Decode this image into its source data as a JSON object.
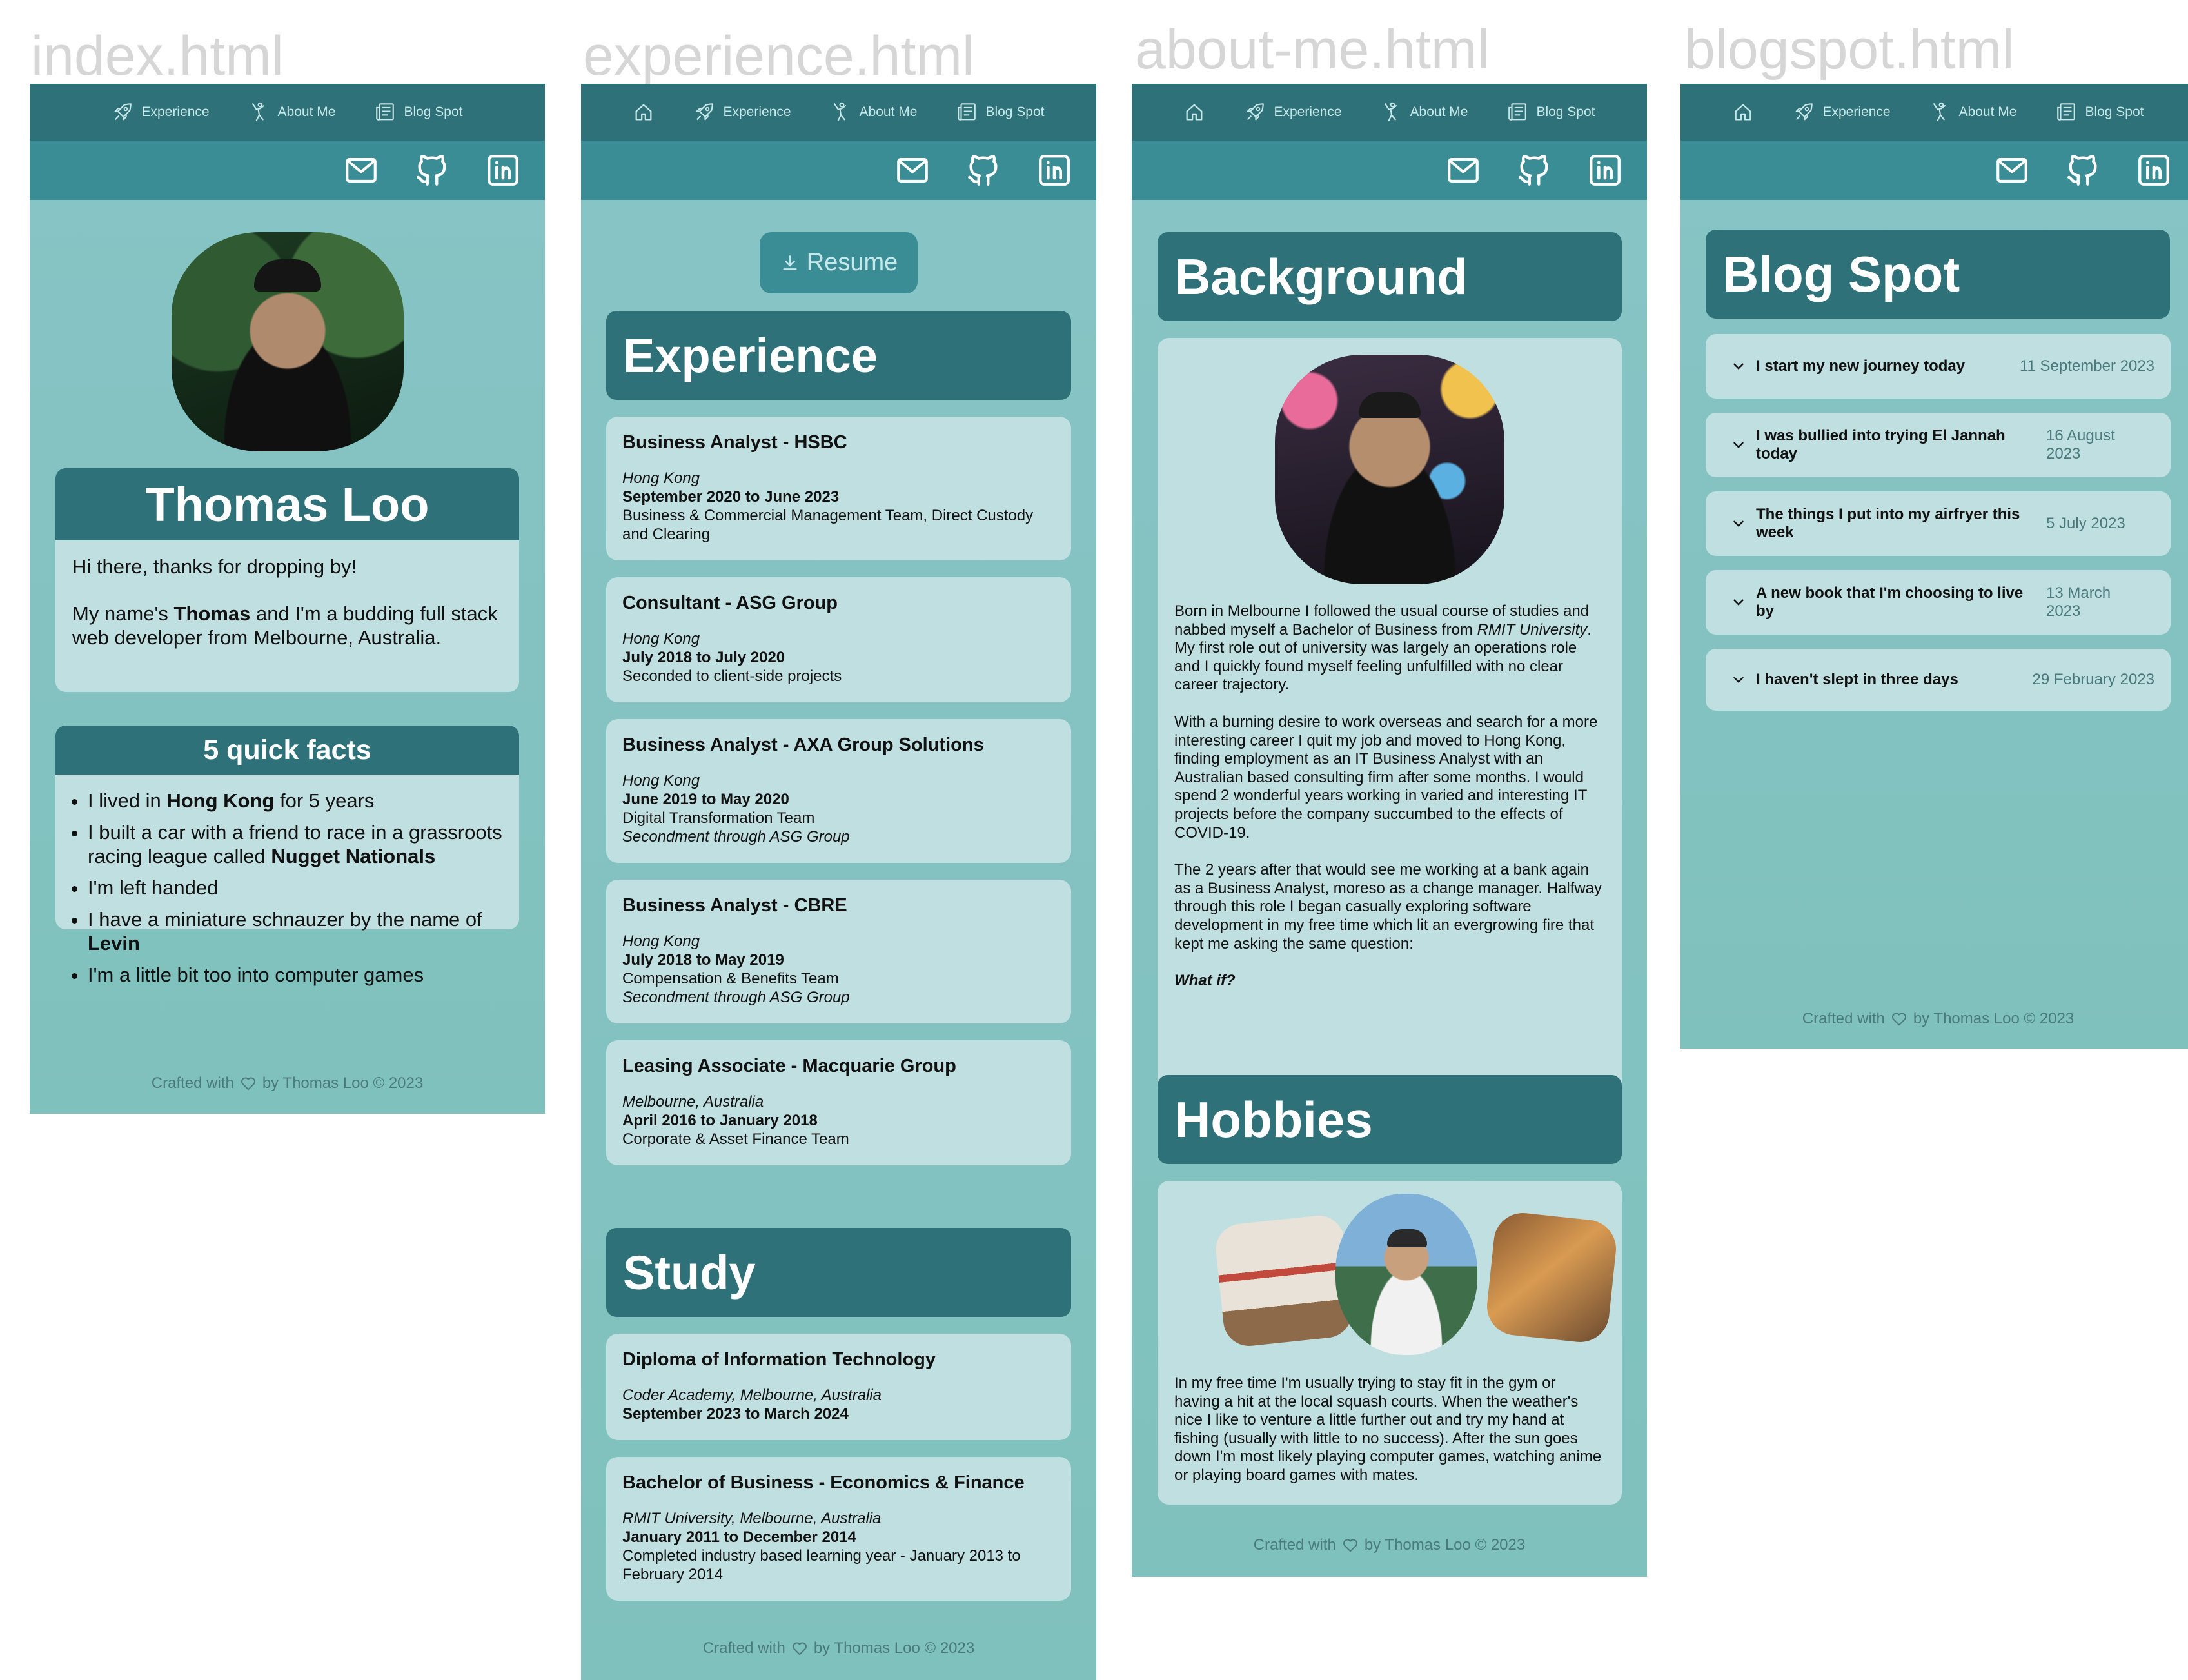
{
  "page_labels": [
    "index.html",
    "experience.html",
    "about-me.html",
    "blogspot.html"
  ],
  "nav": {
    "home_icon": "home-icon",
    "experience": "Experience",
    "about": "About Me",
    "blog": "Blog Spot"
  },
  "social_icons": [
    "mail-icon",
    "github-icon",
    "linkedin-icon"
  ],
  "footer": {
    "prefix": "Crafted with",
    "suffix": "by Thomas Loo © 2023"
  },
  "index": {
    "name": "Thomas Loo",
    "intro_1": "Hi there, thanks for dropping by!",
    "intro_2a": "My name's ",
    "intro_2b": "Thomas",
    "intro_2c": " and I'm a budding full stack web developer from Melbourne, Australia.",
    "facts_title": "5 quick facts",
    "facts": [
      {
        "a": "I lived in ",
        "b": "Hong Kong",
        "c": " for 5 years"
      },
      {
        "a": "I built a car with a friend to race in a grassroots racing league called ",
        "b": "Nugget Nationals",
        "c": ""
      },
      {
        "a": "I'm left handed",
        "b": "",
        "c": ""
      },
      {
        "a": "I have a miniature schnauzer by the name of ",
        "b": "Levin",
        "c": ""
      },
      {
        "a": "I'm a little bit too into computer games",
        "b": "",
        "c": ""
      }
    ]
  },
  "experience": {
    "resume_label": "Resume",
    "title": "Experience",
    "jobs": [
      {
        "role": "Business Analyst - HSBC",
        "location": "Hong Kong",
        "dates": "September 2020 to June 2023",
        "line1": "Business & Commercial Management Team, Direct Custody and Clearing",
        "line2": ""
      },
      {
        "role": "Consultant - ASG Group",
        "location": "Hong Kong",
        "dates": "July 2018 to July 2020",
        "line1": "Seconded to client-side projects",
        "line2": ""
      },
      {
        "role": "Business Analyst - AXA Group Solutions",
        "location": "Hong Kong",
        "dates": "June 2019 to May 2020",
        "line1": "Digital Transformation Team",
        "line2": "Secondment through ASG Group"
      },
      {
        "role": "Business Analyst - CBRE",
        "location": "Hong Kong",
        "dates": "July 2018 to May 2019",
        "line1": "Compensation & Benefits Team",
        "line2": "Secondment through ASG Group"
      },
      {
        "role": "Leasing Associate - Macquarie Group",
        "location": "Melbourne, Australia",
        "dates": "April 2016 to January 2018",
        "line1": "Corporate & Asset Finance Team",
        "line2": ""
      }
    ],
    "study_title": "Study",
    "study": [
      {
        "role": "Diploma of Information Technology",
        "location": "Coder Academy, Melbourne, Australia",
        "dates": "September 2023 to March 2024",
        "line1": "",
        "line2": ""
      },
      {
        "role": "Bachelor of Business - Economics & Finance",
        "location": "RMIT University, Melbourne, Australia",
        "dates": "January 2011 to December 2014",
        "line1": "Completed industry based learning year - January 2013 to February 2014",
        "line2": ""
      }
    ]
  },
  "about": {
    "background_title": "Background",
    "p1a": "Born in Melbourne I followed the usual course of studies and nabbed myself a Bachelor of Business from ",
    "p1b": "RMIT University",
    "p1c": ". My first role out of university was largely an operations role and I quickly found myself feeling unfulfilled with no clear career trajectory.",
    "p2": "With a burning desire to work overseas and search for a more interesting career I quit my job and moved to Hong Kong, finding employment as an IT Business Analyst with an Australian based consulting firm after some months. I would spend 2 wonderful years working in varied and interesting IT projects before the company succumbed to the effects of COVID-19.",
    "p3": "The 2 years after that would see me working at a bank again as a Business Analyst, moreso as a change manager. Halfway through this role I began casually exploring software development in my free time which lit an evergrowing fire that kept me asking the same question:",
    "p4": "What if?",
    "hobbies_title": "Hobbies",
    "hobbies_text": "In my free time I'm usually trying to stay fit in the gym or having a hit at the local squash courts. When the weather's nice I like to venture a little further out and try my hand at fishing (usually with little to no success). After the sun goes down I'm most likely playing computer games, watching anime or playing board games with mates."
  },
  "blog": {
    "title": "Blog Spot",
    "posts": [
      {
        "title": "I start my new journey today",
        "date": "11 September 2023"
      },
      {
        "title": "I was bullied into trying El Jannah today",
        "date": "16 August 2023"
      },
      {
        "title": "The things I put into my airfryer this week",
        "date": "5 July 2023"
      },
      {
        "title": "A new book that I'm choosing to live by",
        "date": "13 March 2023"
      },
      {
        "title": "I haven't slept in three days",
        "date": "29 February 2023"
      }
    ]
  },
  "colors": {
    "nav": "#2e7178",
    "social_bar": "#3b8d95",
    "page_bg": "#88c4c6",
    "card": "#bfdfe1",
    "header": "#2e7178"
  }
}
